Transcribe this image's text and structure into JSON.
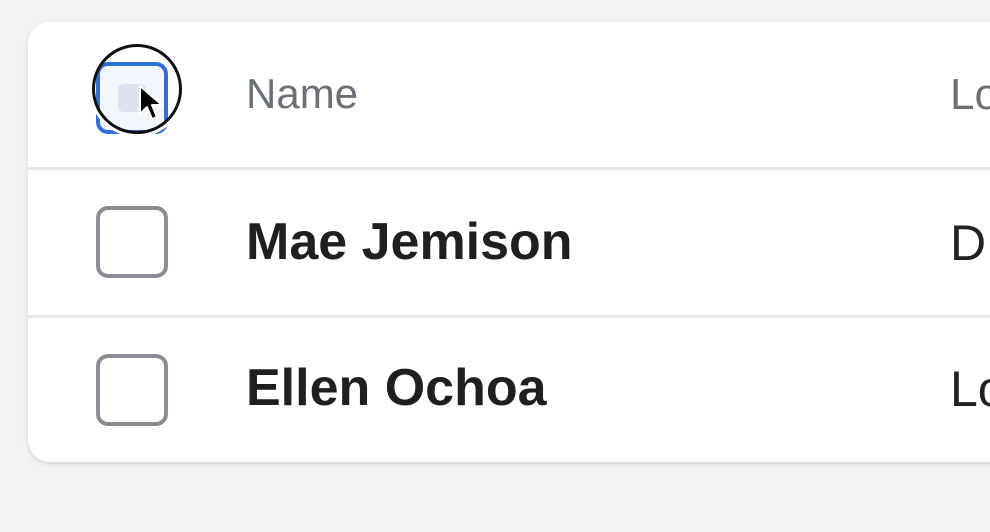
{
  "table": {
    "header": {
      "name": "Name",
      "location": "Lo"
    },
    "rows": [
      {
        "name": "Mae Jemison",
        "location": "D",
        "checked": false
      },
      {
        "name": "Ellen Ochoa",
        "location": "Lo",
        "checked": false
      }
    ]
  },
  "colors": {
    "focus": "#2f6fd6",
    "checkbox_border": "#8a8d93"
  }
}
